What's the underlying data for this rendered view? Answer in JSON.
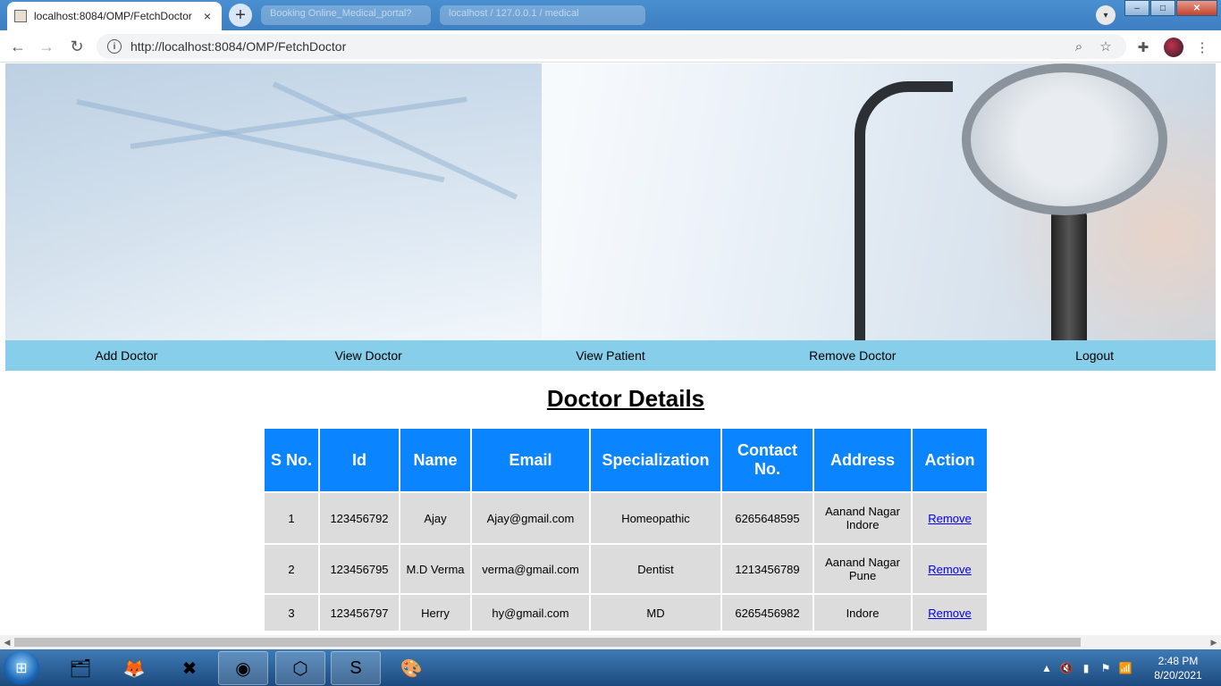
{
  "browser": {
    "active_tab_title": "localhost:8084/OMP/FetchDoctor",
    "inactive_tab_1": "Booking Online_Medical_portal?",
    "inactive_tab_2": "localhost / 127.0.0.1 / medical",
    "url": "http://localhost:8084/OMP/FetchDoctor",
    "new_tab_label": "+",
    "close_label": "×"
  },
  "nav": {
    "items": [
      "Add Doctor",
      "View Doctor",
      "View Patient",
      "Remove Doctor",
      "Logout"
    ]
  },
  "page": {
    "heading": "Doctor Details"
  },
  "table": {
    "headers": [
      "S No.",
      "Id",
      "Name",
      "Email",
      "Specialization",
      "Contact No.",
      "Address",
      "Action"
    ],
    "rows": [
      [
        "1",
        "123456792",
        "Ajay",
        "Ajay@gmail.com",
        "Homeopathic",
        "6265648595",
        "Aanand Nagar Indore",
        "Remove"
      ],
      [
        "2",
        "123456795",
        "M.D Verma",
        "verma@gmail.com",
        "Dentist",
        "1213456789",
        "Aanand Nagar Pune",
        "Remove"
      ],
      [
        "3",
        "123456797",
        "Herry",
        "hy@gmail.com",
        "MD",
        "6265456982",
        "Indore",
        "Remove"
      ]
    ]
  },
  "taskbar": {
    "time": "2:48 PM",
    "date": "8/20/2021"
  },
  "colors": {
    "navbar": "#87ceeb",
    "table_header": "#0a84ff",
    "table_cell": "#dcdcdc"
  }
}
